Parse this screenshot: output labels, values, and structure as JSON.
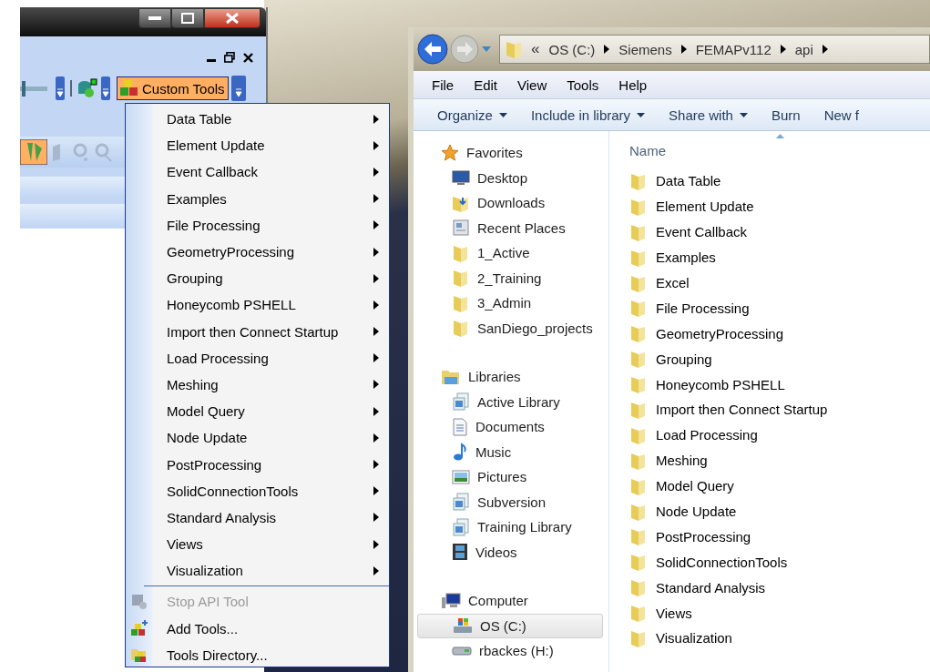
{
  "femap": {
    "toolbar_button": {
      "label": "Custom Tools",
      "selected": true
    }
  },
  "menu": {
    "items": [
      {
        "label": "Data Table",
        "kind": "submenu",
        "disabled": false
      },
      {
        "label": "Element Update",
        "kind": "submenu",
        "disabled": false
      },
      {
        "label": "Event Callback",
        "kind": "submenu",
        "disabled": false
      },
      {
        "label": "Examples",
        "kind": "submenu",
        "disabled": false
      },
      {
        "label": "File Processing",
        "kind": "submenu",
        "disabled": false
      },
      {
        "label": "GeometryProcessing",
        "kind": "submenu",
        "disabled": false
      },
      {
        "label": "Grouping",
        "kind": "submenu",
        "disabled": false
      },
      {
        "label": "Honeycomb PSHELL",
        "kind": "submenu",
        "disabled": false
      },
      {
        "label": "Import then Connect Startup",
        "kind": "submenu",
        "disabled": false
      },
      {
        "label": "Load Processing",
        "kind": "submenu",
        "disabled": false
      },
      {
        "label": "Meshing",
        "kind": "submenu",
        "disabled": false
      },
      {
        "label": "Model Query",
        "kind": "submenu",
        "disabled": false
      },
      {
        "label": "Node Update",
        "kind": "submenu",
        "disabled": false
      },
      {
        "label": "PostProcessing",
        "kind": "submenu",
        "disabled": false
      },
      {
        "label": "SolidConnectionTools",
        "kind": "submenu",
        "disabled": false
      },
      {
        "label": "Standard Analysis",
        "kind": "submenu",
        "disabled": false
      },
      {
        "label": "Views",
        "kind": "submenu",
        "disabled": false
      },
      {
        "label": "Visualization",
        "kind": "submenu",
        "disabled": false
      },
      {
        "kind": "separator"
      },
      {
        "label": "Stop API Tool",
        "kind": "stop",
        "disabled": true
      },
      {
        "label": "Add Tools...",
        "kind": "add",
        "disabled": false
      },
      {
        "label": "Tools Directory...",
        "kind": "directory",
        "disabled": false
      }
    ]
  },
  "explorer": {
    "address": {
      "overflow": "«",
      "crumbs": [
        "OS (C:)",
        "Siemens",
        "FEMAPv112",
        "api"
      ]
    },
    "menubar": [
      "File",
      "Edit",
      "View",
      "Tools",
      "Help"
    ],
    "toolbar": [
      {
        "label": "Organize",
        "dropdown": true
      },
      {
        "label": "Include in library",
        "dropdown": true
      },
      {
        "label": "Share with",
        "dropdown": true
      },
      {
        "label": "Burn",
        "dropdown": false
      },
      {
        "label": "New f",
        "dropdown": false
      }
    ],
    "nav": [
      {
        "label": "Favorites",
        "kind": "favorites",
        "selected": false,
        "children": [
          {
            "label": "Desktop",
            "kind": "desktop",
            "selected": false
          },
          {
            "label": "Downloads",
            "kind": "downloads",
            "selected": false
          },
          {
            "label": "Recent Places",
            "kind": "recent",
            "selected": false
          },
          {
            "label": "1_Active",
            "kind": "folder",
            "selected": false
          },
          {
            "label": "2_Training",
            "kind": "folder",
            "selected": false
          },
          {
            "label": "3_Admin",
            "kind": "folder",
            "selected": false
          },
          {
            "label": "SanDiego_projects",
            "kind": "folder",
            "selected": false
          }
        ]
      },
      {
        "label": "Libraries",
        "kind": "libraries",
        "selected": false,
        "children": [
          {
            "label": "Active Library",
            "kind": "library",
            "selected": false
          },
          {
            "label": "Documents",
            "kind": "documents",
            "selected": false
          },
          {
            "label": "Music",
            "kind": "music",
            "selected": false
          },
          {
            "label": "Pictures",
            "kind": "pictures",
            "selected": false
          },
          {
            "label": "Subversion",
            "kind": "library",
            "selected": false
          },
          {
            "label": "Training Library",
            "kind": "library",
            "selected": false
          },
          {
            "label": "Videos",
            "kind": "videos",
            "selected": false
          }
        ]
      },
      {
        "label": "Computer",
        "kind": "computer",
        "selected": false,
        "children": [
          {
            "label": "OS (C:)",
            "kind": "drive",
            "selected": true
          },
          {
            "label": "rbackes (H:)",
            "kind": "netdrive",
            "selected": false
          }
        ]
      }
    ],
    "column": "Name",
    "files": [
      "Data Table",
      "Element Update",
      "Event Callback",
      "Examples",
      "Excel",
      "File Processing",
      "GeometryProcessing",
      "Grouping",
      "Honeycomb PSHELL",
      "Import then Connect Startup",
      "Load Processing",
      "Meshing",
      "Model Query",
      "Node Update",
      "PostProcessing",
      "SolidConnectionTools",
      "Standard Analysis",
      "Views",
      "Visualization"
    ]
  }
}
